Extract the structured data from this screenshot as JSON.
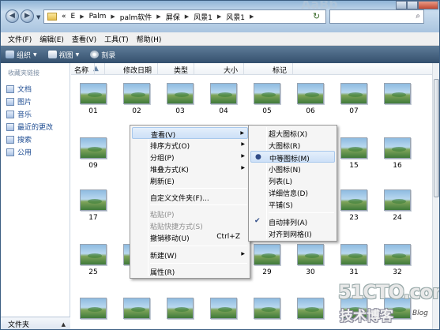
{
  "address": {
    "history_marker": "«",
    "segments": [
      "E",
      "Palm",
      "palm软件",
      "屏保",
      "风景1",
      "风景1"
    ],
    "search_placeholder": ""
  },
  "menubar": [
    "文件(F)",
    "编辑(E)",
    "查看(V)",
    "工具(T)",
    "帮助(H)"
  ],
  "toolbar": {
    "organize": "组织",
    "views": "视图",
    "burn": "刻录"
  },
  "nav": {
    "header": "收藏夹链接",
    "items": [
      "文档",
      "图片",
      "音乐",
      "最近的更改",
      "搜索",
      "公用"
    ],
    "folders_label": "文件夹"
  },
  "columns": [
    "名称",
    "修改日期",
    "类型",
    "大小",
    "标记"
  ],
  "thumbnails": {
    "row1": [
      "01",
      "02",
      "03",
      "04",
      "05",
      "06",
      "07"
    ],
    "row2": [
      "09",
      "15",
      "16"
    ],
    "row3": [
      "17",
      "23",
      "24"
    ],
    "row4": [
      "25",
      "29",
      "30",
      "31",
      "32"
    ]
  },
  "context_menu": [
    {
      "label": "查看(V)",
      "submenu": true
    },
    {
      "label": "排序方式(O)",
      "submenu": true
    },
    {
      "label": "分组(P)",
      "submenu": true
    },
    {
      "label": "堆叠方式(K)",
      "submenu": true
    },
    {
      "label": "刷新(E)"
    },
    {
      "label": "自定义文件夹(F)..."
    },
    {
      "label": "粘贴(P)",
      "disabled": true
    },
    {
      "label": "粘贴快捷方式(S)",
      "disabled": true
    },
    {
      "label": "撤销移动(U)",
      "shortcut": "Ctrl+Z"
    },
    {
      "label": "新建(W)",
      "submenu": true
    },
    {
      "label": "属性(R)"
    }
  ],
  "view_submenu": [
    {
      "label": "超大图标(X)"
    },
    {
      "label": "大图标(R)"
    },
    {
      "label": "中等图标(M)",
      "selected": true
    },
    {
      "label": "小图标(N)"
    },
    {
      "label": "列表(L)"
    },
    {
      "label": "详细信息(D)"
    },
    {
      "label": "平铺(S)"
    },
    {
      "label": "自动排列(A)",
      "checked": true
    },
    {
      "label": "对齐到网格(I)"
    }
  ],
  "watermark": {
    "site": "51CTO.com",
    "cn": "技术博客",
    "blog": "Blog"
  },
  "colors": {
    "toolbar": "#3f5d7d",
    "menu_highlight": "#cde0f7",
    "link": "#1e4c92"
  }
}
